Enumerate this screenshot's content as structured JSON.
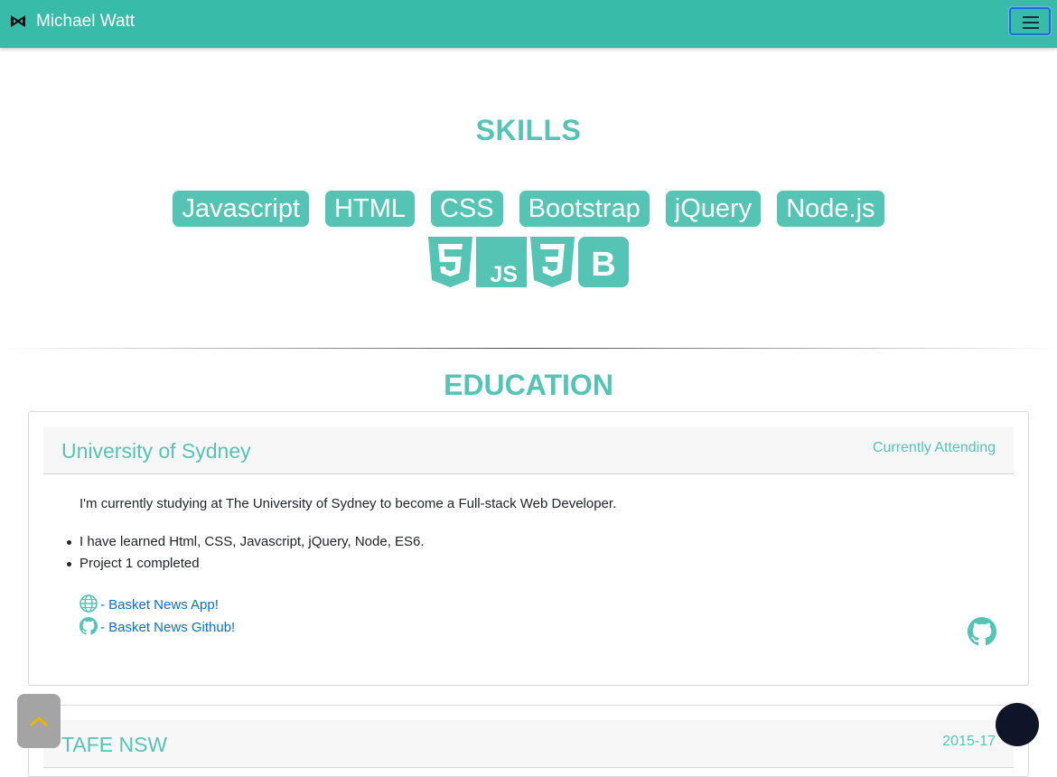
{
  "navbar": {
    "brand": "Michael Watt",
    "brand_icon": "bowtie-logo-icon",
    "toggler_icon": "hamburger-menu-icon"
  },
  "skills": {
    "title": "SKILLS",
    "tags": [
      "Javascript",
      "HTML",
      "CSS",
      "Bootstrap",
      "jQuery",
      "Node.js"
    ],
    "logos": [
      "html5-icon",
      "js-icon",
      "css3-icon",
      "bootstrap-icon"
    ]
  },
  "education": {
    "title": "EDUCATION",
    "entries": [
      {
        "school": "University of Sydney",
        "period": "Currently Attending",
        "description": "I'm currently studying at The University of Sydney to become a Full-stack Web Developer.",
        "bullets": [
          "I have learned Html, CSS, Javascript, jQuery, Node, ES6.",
          "Project 1 completed"
        ],
        "links": [
          {
            "icon": "globe-icon",
            "label": "- Basket News App!"
          },
          {
            "icon": "github-icon",
            "label": "- Basket News Github!"
          }
        ]
      },
      {
        "school": "TAFE NSW",
        "period": "2015-17"
      }
    ]
  },
  "colors": {
    "accent": "#55c4b4",
    "navbar": "#38bba9",
    "link": "#0a6fd6",
    "scroll_top": "#a4a4a4",
    "scroll_top_arrow": "#e6b800",
    "chat": "#0f1429"
  },
  "floating": {
    "scroll_top_icon": "chevron-up-icon",
    "chat_icon": "chat-bubble-icon"
  }
}
